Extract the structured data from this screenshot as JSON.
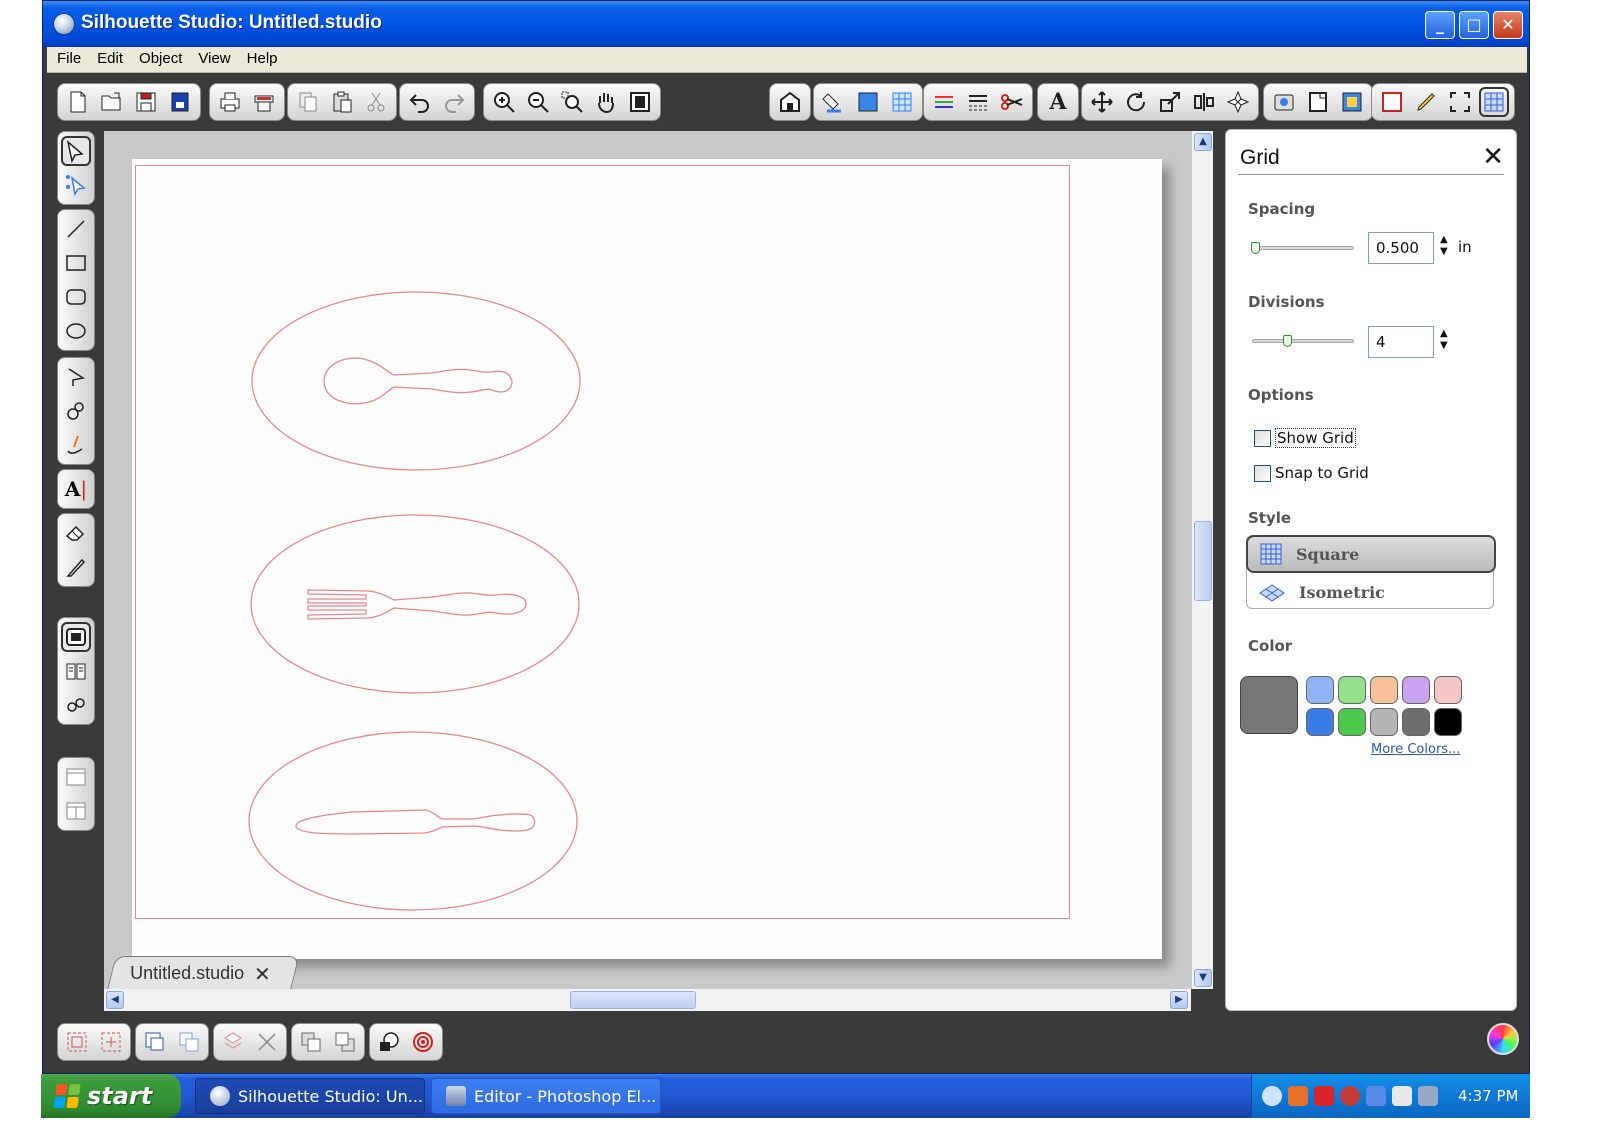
{
  "window": {
    "title": "Silhouette Studio: Untitled.studio",
    "minimize_glyph": "_",
    "maximize_glyph": "□",
    "close_glyph": "✕"
  },
  "menu": [
    "File",
    "Edit",
    "Object",
    "View",
    "Help"
  ],
  "document_tab": {
    "label": "Untitled.studio",
    "close_glyph": "✕"
  },
  "canvas": {
    "shapes": [
      "spoon-in-oval",
      "fork-in-oval",
      "knife-in-oval"
    ],
    "cut_line_color": "#e8878a"
  },
  "grid_panel": {
    "title": "Grid",
    "close_glyph": "✕",
    "spacing": {
      "label": "Spacing",
      "value": "0.500",
      "unit": "in"
    },
    "divisions": {
      "label": "Divisions",
      "value": "4"
    },
    "options": {
      "label": "Options",
      "show_grid": {
        "label": "Show Grid",
        "checked": false
      },
      "snap_to_grid": {
        "label": "Snap to Grid",
        "checked": false
      }
    },
    "style": {
      "label": "Style",
      "items": [
        {
          "label": "Square",
          "selected": true
        },
        {
          "label": "Isometric",
          "selected": false
        }
      ]
    },
    "color": {
      "label": "Color",
      "current": "#777777",
      "swatches": [
        "#8fb3f5",
        "#93e28a",
        "#f5c29a",
        "#c9a3f0",
        "#f5c6c6",
        "#3a7de8",
        "#4cc94c",
        "#b5b5b5",
        "#6e6e6e",
        "#000000"
      ],
      "more_colors": "More Colors..."
    }
  },
  "taskbar": {
    "start_label": "start",
    "tasks": [
      "Silhouette Studio: Un...",
      "Editor - Photoshop El..."
    ],
    "clock": "4:37 PM"
  }
}
